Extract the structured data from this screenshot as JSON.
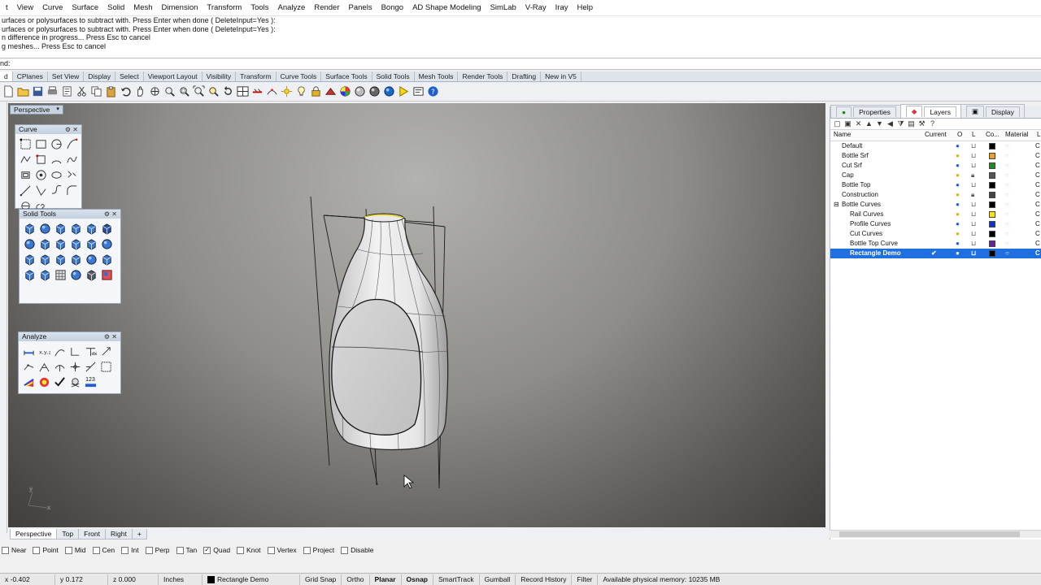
{
  "menubar": [
    "t",
    "View",
    "Curve",
    "Surface",
    "Solid",
    "Mesh",
    "Dimension",
    "Transform",
    "Tools",
    "Analyze",
    "Render",
    "Panels",
    "Bongo",
    "AD Shape Modeling",
    "SimLab",
    "V-Ray",
    "Iray",
    "Help"
  ],
  "history": [
    "urfaces or polysurfaces to subtract with. Press Enter when done ( DeleteInput=Yes ):",
    "urfaces or polysurfaces to subtract with. Press Enter when done ( DeleteInput=Yes ):",
    "n difference in progress... Press Esc to cancel",
    "g meshes... Press Esc to cancel"
  ],
  "command_prompt": "nd:",
  "toolbar_tabs": [
    "d",
    "CPlanes",
    "Set View",
    "Display",
    "Select",
    "Viewport Layout",
    "Visibility",
    "Transform",
    "Curve Tools",
    "Surface Tools",
    "Solid Tools",
    "Mesh Tools",
    "Render Tools",
    "Drafting",
    "New in V5"
  ],
  "viewport": {
    "label": "Perspective",
    "dropdown": "▾"
  },
  "panels": {
    "curve": {
      "title": "Curve"
    },
    "solid_tools": {
      "title": "Solid Tools"
    },
    "analyze": {
      "title": "Analyze",
      "badge": "123"
    }
  },
  "view_tabs": [
    "Perspective",
    "Top",
    "Front",
    "Right",
    "+"
  ],
  "osnaps": [
    {
      "label": "Near",
      "checked": false
    },
    {
      "label": "Point",
      "checked": false
    },
    {
      "label": "Mid",
      "checked": false
    },
    {
      "label": "Cen",
      "checked": false
    },
    {
      "label": "Int",
      "checked": false
    },
    {
      "label": "Perp",
      "checked": false
    },
    {
      "label": "Tan",
      "checked": false
    },
    {
      "label": "Quad",
      "checked": true
    },
    {
      "label": "Knot",
      "checked": false
    },
    {
      "label": "Vertex",
      "checked": false
    },
    {
      "label": "Project",
      "checked": false
    },
    {
      "label": "Disable",
      "checked": false
    }
  ],
  "status": {
    "x": "x -0.402",
    "y": "y 0.172",
    "z": "z 0.000",
    "units": "Inches",
    "layer": "Rectangle Demo",
    "grid_snap": "Grid Snap",
    "ortho": "Ortho",
    "planar": "Planar",
    "osnap": "Osnap",
    "smarttrack": "SmartTrack",
    "gumball": "Gumball",
    "record_history": "Record History",
    "filter": "Filter",
    "memory": "Available physical memory: 10235 MB"
  },
  "right_panel": {
    "tabs": [
      "Properties",
      "Layers",
      "Display"
    ],
    "columns": {
      "name": "Name",
      "current": "Current",
      "on": "O",
      "lock": "L",
      "color": "Co...",
      "material": "Material",
      "linetype": "L"
    },
    "layers": [
      {
        "name": "Default",
        "indent": 0,
        "current": "",
        "color": "#000000"
      },
      {
        "name": "Bottle Srf",
        "indent": 0,
        "current": "",
        "color": "#f0a020"
      },
      {
        "name": "Cut Srf",
        "indent": 0,
        "current": "",
        "color": "#1f8a1f"
      },
      {
        "name": "Cap",
        "indent": 0,
        "current": "",
        "color": "#555555"
      },
      {
        "name": "Bottle Top",
        "indent": 0,
        "current": "",
        "color": "#000000"
      },
      {
        "name": "Construction",
        "indent": 0,
        "current": "",
        "color": "#444444"
      },
      {
        "name": "Bottle Curves",
        "indent": 0,
        "current": "",
        "color": "#000000",
        "expander": "⊟"
      },
      {
        "name": "Rail Curves",
        "indent": 1,
        "current": "",
        "color": "#ffe400"
      },
      {
        "name": "Profile Curves",
        "indent": 1,
        "current": "",
        "color": "#1030d0"
      },
      {
        "name": "Cut Curves",
        "indent": 1,
        "current": "",
        "color": "#000000"
      },
      {
        "name": "Bottle Top Curve",
        "indent": 1,
        "current": "",
        "color": "#6a1fa0"
      },
      {
        "name": "Rectangle Demo",
        "indent": 1,
        "current": "✔",
        "color": "#000000",
        "selected": true
      }
    ],
    "linetype_cut": "C"
  },
  "colors": {
    "accent": "#1f6fe0",
    "selected_row": "#1f6fe0"
  }
}
